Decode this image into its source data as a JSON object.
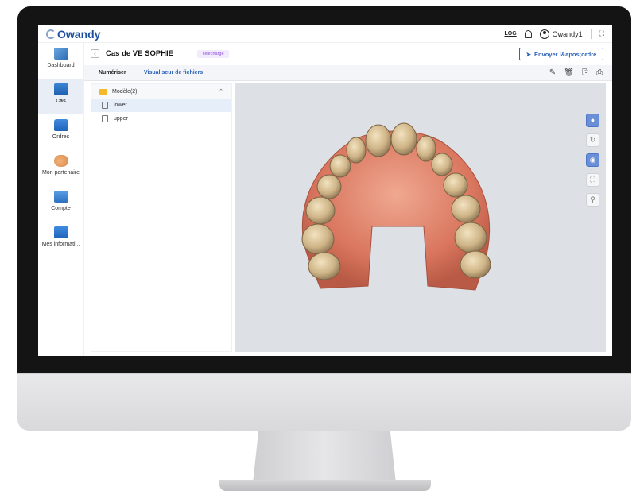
{
  "topbar": {
    "logo_text": "Owandy",
    "log_label": "LOG",
    "user_name": "Owandy1"
  },
  "sidebar": {
    "items": [
      {
        "label": "Dashboard",
        "icon": "dashboard-icon"
      },
      {
        "label": "Cas",
        "icon": "folder-icon"
      },
      {
        "label": "Ordres",
        "icon": "orders-icon"
      },
      {
        "label": "Mon partenaire",
        "icon": "handshake-icon"
      },
      {
        "label": "Compte",
        "icon": "account-icon"
      },
      {
        "label": "Mes informati...",
        "icon": "info-icon"
      }
    ],
    "active": "Cas"
  },
  "case": {
    "title": "Cas de VE SOPHIE",
    "status_badge": "Téléchargé",
    "send_button": "Envoyer l&apos;ordre"
  },
  "tabs": [
    {
      "label": "Numériser"
    },
    {
      "label": "Visualiseur de fichiers",
      "active": true
    }
  ],
  "files": {
    "folder": "Modèle(2)",
    "items": [
      {
        "name": "lower",
        "selected": true
      },
      {
        "name": "upper",
        "selected": false
      }
    ]
  },
  "colors": {
    "accent": "#2d63b8",
    "badge": "#8c4fd8",
    "viewer_bg": "#dde1e6"
  }
}
